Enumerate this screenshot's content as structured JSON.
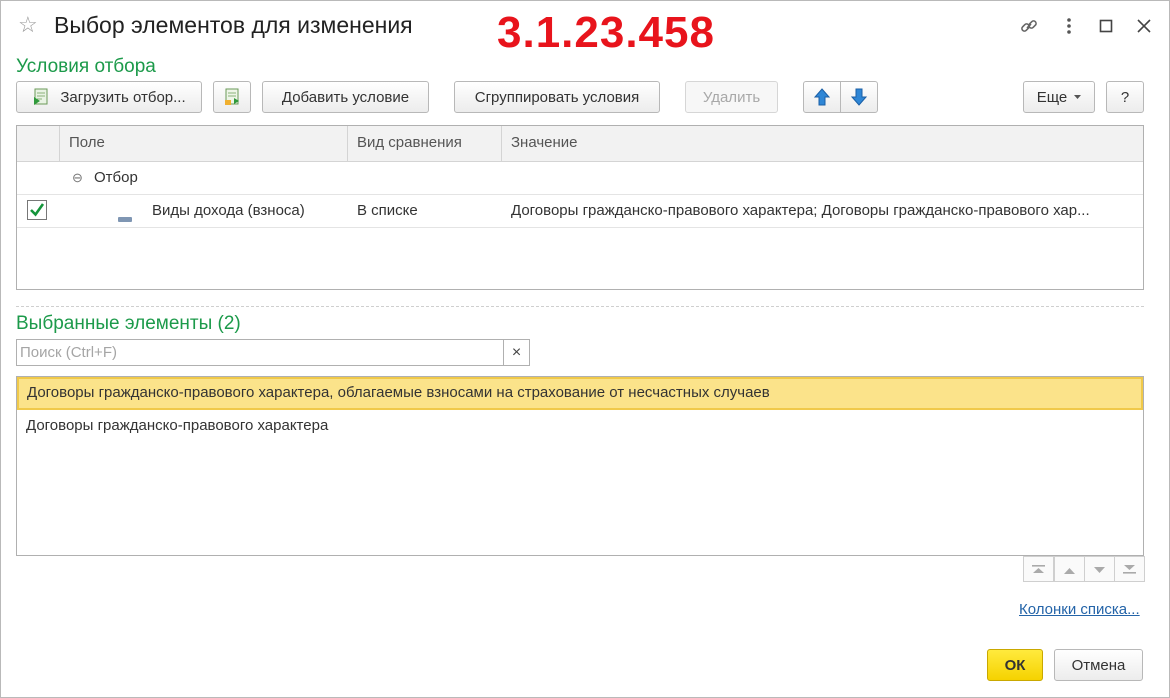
{
  "window": {
    "title": "Выбор элементов для изменения",
    "version_overlay": "3.1.23.458"
  },
  "filter_section": {
    "title": "Условия отбора",
    "toolbar": {
      "load_filter": "Загрузить отбор...",
      "add_condition": "Добавить условие",
      "group_conditions": "Сгруппировать условия",
      "delete": "Удалить",
      "more": "Еще",
      "help": "?"
    },
    "columns": {
      "field": "Поле",
      "comparison": "Вид сравнения",
      "value": "Значение"
    },
    "group_row": {
      "label": "Отбор"
    },
    "rows": [
      {
        "checked": true,
        "field": "Виды дохода (взноса)",
        "comparison": "В списке",
        "value": "Договоры гражданско-правового характера; Договоры гражданско-правового хар..."
      }
    ]
  },
  "selected_section": {
    "title": "Выбранные элементы (2)",
    "search": {
      "placeholder": "Поиск (Ctrl+F)",
      "clear": "×"
    },
    "items": [
      {
        "label": "Договоры гражданско-правового характера, облагаемые взносами на страхование от несчастных случаев",
        "selected": true
      },
      {
        "label": "Договоры гражданско-правового характера",
        "selected": false
      }
    ],
    "columns_link": "Колонки списка..."
  },
  "footer": {
    "ok": "ОК",
    "cancel": "Отмена"
  },
  "colors": {
    "section_title": "#1c9a4a",
    "version_overlay": "#e8141c",
    "selection_fill": "#fbe38a",
    "ok_button": "#f5d200"
  }
}
